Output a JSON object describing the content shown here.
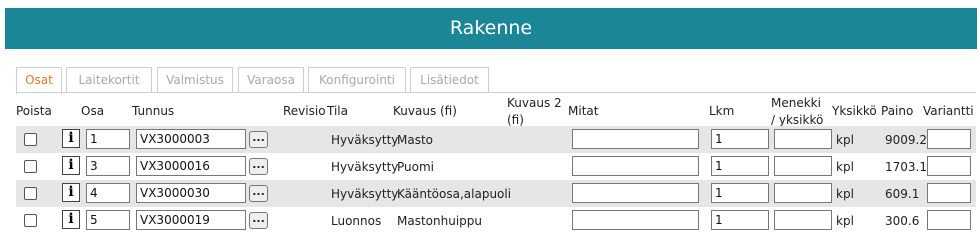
{
  "header": {
    "title": "Rakenne"
  },
  "tabs": [
    {
      "label": "Osat",
      "active": true
    },
    {
      "label": "Laitekortit",
      "active": false
    },
    {
      "label": "Valmistus",
      "active": false
    },
    {
      "label": "Varaosa",
      "active": false
    },
    {
      "label": "Konfigurointi",
      "active": false
    },
    {
      "label": "Lisätiedot",
      "active": false
    }
  ],
  "columns": {
    "poista": "Poista",
    "osa": "Osa",
    "tunnus": "Tunnus",
    "revisio": "Revisio",
    "tila": "Tila",
    "kuvaus_fi": "Kuvaus (fi)",
    "kuvaus2_line1": "Kuvaus 2",
    "kuvaus2_line2": "(fi)",
    "mitat": "Mitat",
    "lkm": "Lkm",
    "menekki_line1": "Menekki",
    "menekki_line2": "/ yksikkö",
    "yksikko": "Yksikkö",
    "paino": "Paino",
    "variantti": "Variantti"
  },
  "info_button_label": "i",
  "browse_button_label": "...",
  "rows": [
    {
      "osa": "1",
      "tunnus": "VX3000003",
      "tila": "Hyväksytty",
      "kuvaus": "Masto",
      "mitat": "",
      "lkm": "1",
      "menekki": "",
      "yksikko": "kpl",
      "paino": "9009.2",
      "variantti": ""
    },
    {
      "osa": "3",
      "tunnus": "VX3000016",
      "tila": "Hyväksytty",
      "kuvaus": "Puomi",
      "mitat": "",
      "lkm": "1",
      "menekki": "",
      "yksikko": "kpl",
      "paino": "1703.1",
      "variantti": ""
    },
    {
      "osa": "4",
      "tunnus": "VX3000030",
      "tila": "Hyväksytty",
      "kuvaus": "Kääntöosa,alapuoli",
      "mitat": "",
      "lkm": "1",
      "menekki": "",
      "yksikko": "kpl",
      "paino": "609.1",
      "variantti": ""
    },
    {
      "osa": "5",
      "tunnus": "VX3000019",
      "tila": "Luonnos",
      "kuvaus": "Mastonhuippu",
      "mitat": "",
      "lkm": "1",
      "menekki": "",
      "yksikko": "kpl",
      "paino": "300.6",
      "variantti": ""
    }
  ]
}
